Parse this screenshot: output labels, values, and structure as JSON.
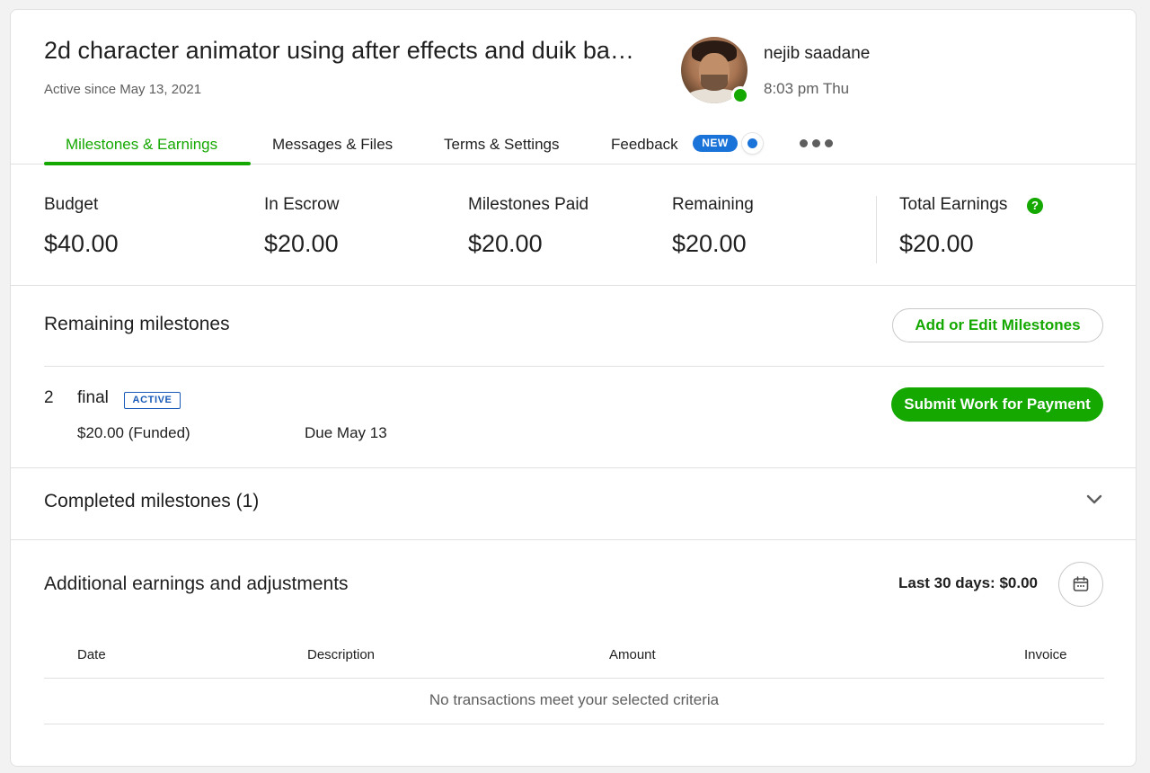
{
  "header": {
    "title": "2d character animator using after effects and duik ba…",
    "active_since": "Active since May 13, 2021"
  },
  "user": {
    "name": "nejib saadane",
    "local_time": "8:03 pm Thu",
    "status": "online"
  },
  "tabs": [
    {
      "label": "Milestones & Earnings",
      "active": true
    },
    {
      "label": "Messages & Files",
      "active": false
    },
    {
      "label": "Terms & Settings",
      "active": false
    },
    {
      "label": "Feedback",
      "active": false,
      "badge": "NEW"
    }
  ],
  "stats": {
    "budget": {
      "label": "Budget",
      "value": "$40.00"
    },
    "escrow": {
      "label": "In Escrow",
      "value": "$20.00"
    },
    "paid": {
      "label": "Milestones Paid",
      "value": "$20.00"
    },
    "remaining": {
      "label": "Remaining",
      "value": "$20.00"
    },
    "total": {
      "label": "Total Earnings",
      "value": "$20.00"
    }
  },
  "remaining_milestones": {
    "title": "Remaining milestones",
    "add_button": "Add or Edit Milestones",
    "items": [
      {
        "number": "2",
        "name": "final",
        "status": "ACTIVE",
        "amount": "$20.00 (Funded)",
        "due": "Due May 13",
        "action": "Submit Work for Payment"
      }
    ]
  },
  "completed_milestones": {
    "title": "Completed milestones (1)"
  },
  "adjustments": {
    "title": "Additional earnings and adjustments",
    "period_summary": "Last 30 days: $0.00",
    "columns": [
      "Date",
      "Description",
      "Amount",
      "Invoice"
    ],
    "empty_message": "No transactions meet your selected criteria"
  },
  "colors": {
    "accent": "#14a800",
    "badge_blue": "#1a73d9",
    "active_badge": "#1a5bb8"
  },
  "icons": {
    "help": "question-circle-icon",
    "more": "more-horizontal-icon",
    "chevron": "chevron-down-icon",
    "calendar": "calendar-icon"
  }
}
